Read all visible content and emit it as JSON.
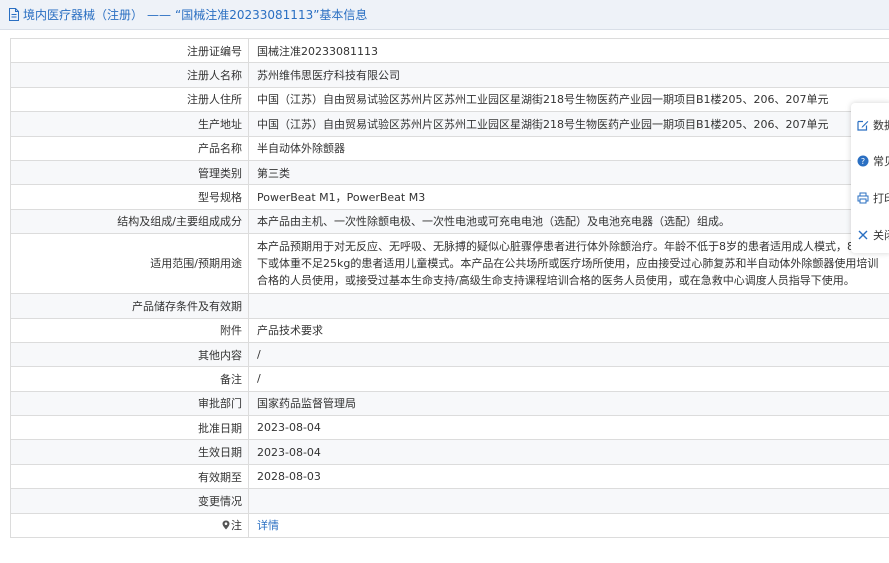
{
  "breadcrumb": {
    "crumb": "境内医疗器械（注册）",
    "separator": "——",
    "tail": "“国械注准20233081113”基本信息"
  },
  "rows": [
    {
      "label": "注册证编号",
      "value": "国械注准20233081113"
    },
    {
      "label": "注册人名称",
      "value": "苏州维伟思医疗科技有限公司"
    },
    {
      "label": "注册人住所",
      "value": "中国（江苏）自由贸易试验区苏州片区苏州工业园区星湖街218号生物医药产业园一期项目B1楼205、206、207单元"
    },
    {
      "label": "生产地址",
      "value": "中国（江苏）自由贸易试验区苏州片区苏州工业园区星湖街218号生物医药产业园一期项目B1楼205、206、207单元"
    },
    {
      "label": "产品名称",
      "value": "半自动体外除颤器"
    },
    {
      "label": "管理类别",
      "value": "第三类"
    },
    {
      "label": "型号规格",
      "value": "PowerBeat M1，PowerBeat M3"
    },
    {
      "label": "结构及组成/主要组成成分",
      "value": "本产品由主机、一次性除颤电极、一次性电池或可充电电池（选配）及电池充电器（选配）组成。"
    },
    {
      "label": "适用范围/预期用途",
      "value": "本产品预期用于对无反应、无呼吸、无脉搏的疑似心脏骤停患者进行体外除颤治疗。年龄不低于8岁的患者适用成人模式，8岁以下或体重不足25kg的患者适用儿童模式。本产品在公共场所或医疗场所使用，应由接受过心肺复苏和半自动体外除颤器使用培训合格的人员使用，或接受过基本生命支持/高级生命支持课程培训合格的医务人员使用，或在急救中心调度人员指导下使用。"
    },
    {
      "label": "产品储存条件及有效期",
      "value": ""
    },
    {
      "label": "附件",
      "value": "产品技术要求"
    },
    {
      "label": "其他内容",
      "value": "/"
    },
    {
      "label": "备注",
      "value": "/"
    },
    {
      "label": "审批部门",
      "value": "国家药品监督管理局"
    },
    {
      "label": "批准日期",
      "value": "2023-08-04"
    },
    {
      "label": "生效日期",
      "value": "2023-08-04"
    },
    {
      "label": "有效期至",
      "value": "2028-08-03"
    },
    {
      "label": "变更情况",
      "value": ""
    },
    {
      "label": "注",
      "value": "详情"
    }
  ],
  "float_menu": [
    {
      "label": "数据",
      "icon": "edit-icon"
    },
    {
      "label": "常见",
      "icon": "help-icon"
    },
    {
      "label": "打印",
      "icon": "print-icon"
    },
    {
      "label": "关闭",
      "icon": "close-icon"
    }
  ],
  "colors": {
    "link": "#2a6fc2",
    "titlebar_bg": "#eef2f8",
    "border": "#dcdcdc"
  }
}
